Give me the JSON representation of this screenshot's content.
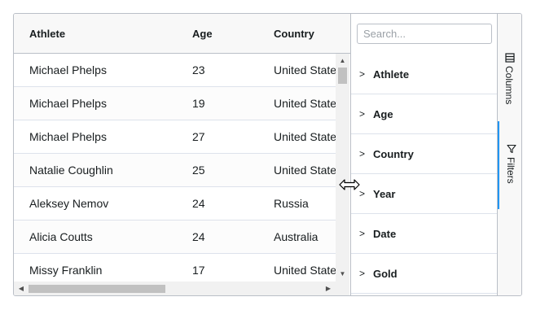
{
  "grid": {
    "columns": [
      {
        "key": "athlete",
        "label": "Athlete"
      },
      {
        "key": "age",
        "label": "Age"
      },
      {
        "key": "country",
        "label": "Country"
      }
    ],
    "rows": [
      {
        "athlete": "Michael Phelps",
        "age": "23",
        "country": "United States"
      },
      {
        "athlete": "Michael Phelps",
        "age": "19",
        "country": "United States"
      },
      {
        "athlete": "Michael Phelps",
        "age": "27",
        "country": "United States"
      },
      {
        "athlete": "Natalie Coughlin",
        "age": "25",
        "country": "United States"
      },
      {
        "athlete": "Aleksey Nemov",
        "age": "24",
        "country": "Russia"
      },
      {
        "athlete": "Alicia Coutts",
        "age": "24",
        "country": "Australia"
      },
      {
        "athlete": "Missy Franklin",
        "age": "17",
        "country": "United States"
      }
    ]
  },
  "tool_panel": {
    "search_placeholder": "Search...",
    "filters": [
      {
        "label": "Athlete"
      },
      {
        "label": "Age"
      },
      {
        "label": "Country"
      },
      {
        "label": "Year"
      },
      {
        "label": "Date"
      },
      {
        "label": "Gold"
      }
    ]
  },
  "side_bar": {
    "columns_label": "Columns",
    "columns_icon": "columns-icon",
    "filters_label": "Filters",
    "filters_icon": "filter-icon",
    "active": "filters"
  },
  "colors": {
    "accent": "#2196f3",
    "border": "#babfc7",
    "header_bg": "#f8f8f8"
  }
}
